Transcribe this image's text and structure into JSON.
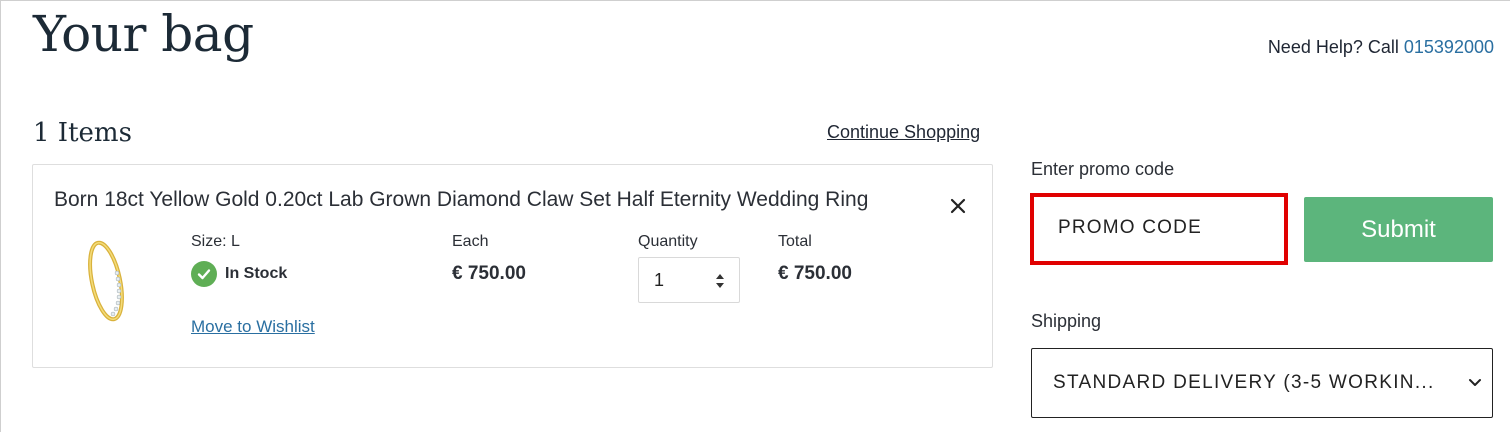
{
  "header": {
    "title": "Your bag",
    "help_text": "Need Help? Call ",
    "help_phone": "015392000"
  },
  "cart": {
    "items_count": "1 Items",
    "continue_label": "Continue Shopping",
    "item": {
      "name": "Born 18ct Yellow Gold 0.20ct Lab Grown Diamond Claw Set Half Eternity Wedding Ring",
      "size": "Size: L",
      "stock": "In Stock",
      "wishlist_label": "Move to Wishlist",
      "each_label": "Each",
      "each_value": "€ 750.00",
      "quantity_label": "Quantity",
      "quantity_value": "1",
      "total_label": "Total",
      "total_value": "€ 750.00",
      "remove_icon": "close-icon",
      "thumbnail": "ring-image"
    }
  },
  "promo": {
    "label": "Enter promo code",
    "placeholder": "PROMO CODE",
    "submit_label": "Submit"
  },
  "shipping": {
    "label": "Shipping",
    "selected": "STANDARD DELIVERY (3-5 WORKIN..."
  },
  "colors": {
    "link": "#2a6fa1",
    "submit_bg": "#5cb57c",
    "stock_green": "#5fae55",
    "promo_highlight": "#e00000"
  }
}
